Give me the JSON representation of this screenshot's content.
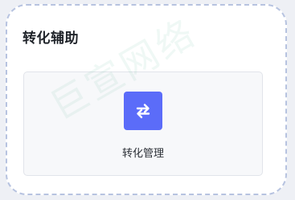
{
  "section": {
    "title": "转化辅助"
  },
  "tiles": [
    {
      "label": "转化管理",
      "icon": "swap-arrows-icon",
      "icon_bg": "#5b6cf9"
    }
  ],
  "watermark": {
    "text": "巨宣网络"
  }
}
